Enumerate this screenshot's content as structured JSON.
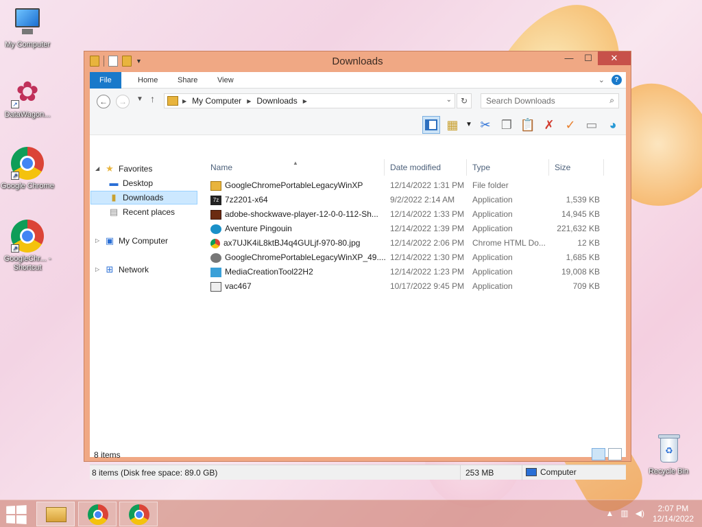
{
  "desktop": {
    "icons": [
      {
        "label": "My Computer",
        "icon": "computer-icon"
      },
      {
        "label": "DataWagon...",
        "icon": "datawagon-icon"
      },
      {
        "label": "Google Chrome",
        "icon": "chrome-icon"
      },
      {
        "label": "GoogleChr... - Shortcut",
        "icon": "chrome-icon"
      },
      {
        "label": "Recycle Bin",
        "icon": "recycle-bin-icon"
      }
    ]
  },
  "window": {
    "title": "Downloads",
    "ribbon_tabs": [
      "File",
      "Home",
      "Share",
      "View"
    ],
    "address": {
      "crumbs": [
        "My Computer",
        "Downloads"
      ]
    },
    "search_placeholder": "Search Downloads",
    "nav": {
      "favorites": "Favorites",
      "desktop": "Desktop",
      "downloads": "Downloads",
      "recent": "Recent places",
      "my_computer": "My Computer",
      "network": "Network"
    },
    "columns": {
      "name": "Name",
      "date": "Date modified",
      "type": "Type",
      "size": "Size"
    },
    "files": [
      {
        "name": "GoogleChromePortableLegacyWinXP",
        "date": "12/14/2022 1:31 PM",
        "type": "File folder",
        "size": "",
        "icon": "folder-icon"
      },
      {
        "name": "7z2201-x64",
        "date": "9/2/2022 2:14 AM",
        "type": "Application",
        "size": "1,539 KB",
        "icon": "7zip-icon"
      },
      {
        "name": "adobe-shockwave-player-12-0-0-112-Sh...",
        "date": "12/14/2022 1:33 PM",
        "type": "Application",
        "size": "14,945 KB",
        "icon": "shockwave-icon"
      },
      {
        "name": "Aventure Pingouin",
        "date": "12/14/2022 1:39 PM",
        "type": "Application",
        "size": "221,632 KB",
        "icon": "penguin-icon"
      },
      {
        "name": "ax7UJK4iL8ktBJ4q4GULjf-970-80.jpg",
        "date": "12/14/2022 2:06 PM",
        "type": "Chrome HTML Do...",
        "size": "12 KB",
        "icon": "chrome-icon"
      },
      {
        "name": "GoogleChromePortableLegacyWinXP_49....",
        "date": "12/14/2022 1:30 PM",
        "type": "Application",
        "size": "1,685 KB",
        "icon": "installer-icon"
      },
      {
        "name": "MediaCreationTool22H2",
        "date": "12/14/2022 1:23 PM",
        "type": "Application",
        "size": "19,008 KB",
        "icon": "media-creation-icon"
      },
      {
        "name": "vac467",
        "date": "10/17/2022 9:45 PM",
        "type": "Application",
        "size": "709 KB",
        "icon": "vac-icon"
      }
    ],
    "items_count": "8 items",
    "status": {
      "left": "8 items (Disk free space: 89.0 GB)",
      "size": "253 MB",
      "location": "Computer"
    }
  },
  "taskbar": {
    "time": "2:07 PM",
    "date": "12/14/2022"
  }
}
